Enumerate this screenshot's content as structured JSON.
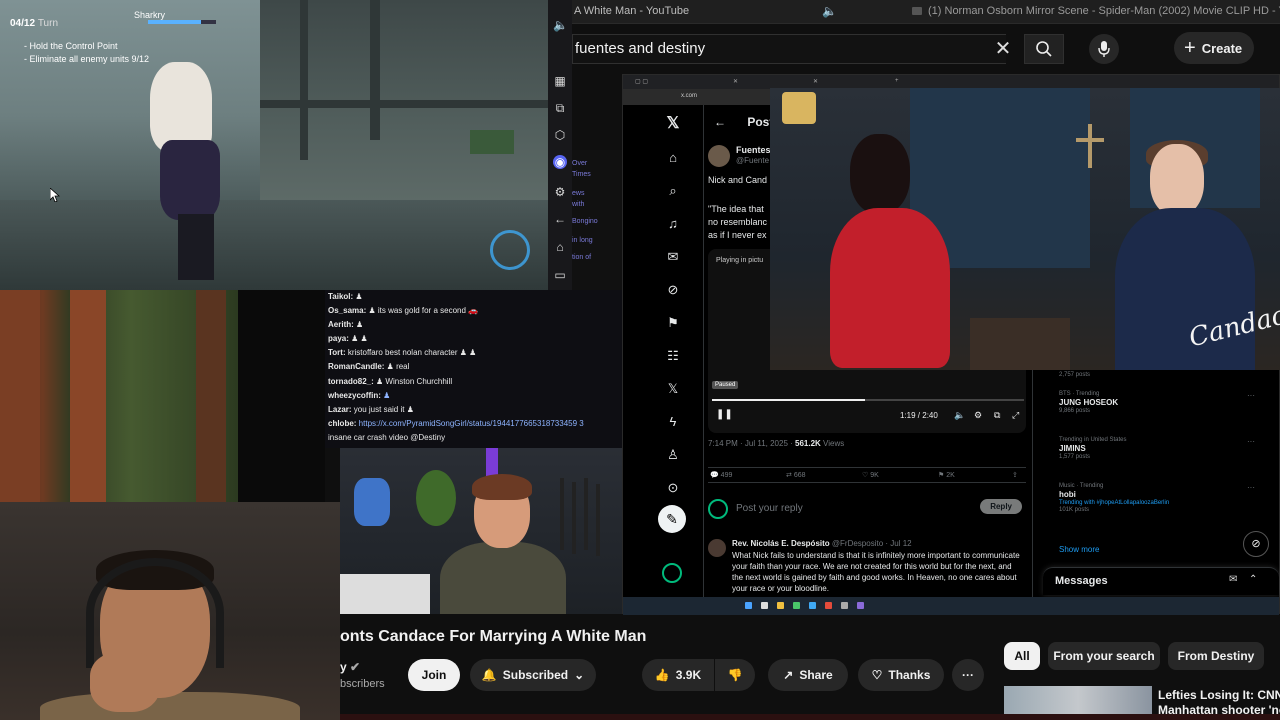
{
  "browser_tabs": {
    "tab1": "A White Man - YouTube",
    "tab2": "(1) Norman Osborn Mirror Scene - Spider-Man (2002) Movie CLIP HD - YouTube"
  },
  "youtube": {
    "search_query": "fuentes and destiny",
    "create_label": "Create",
    "video_title": "onts Candace For Marrying A White Man",
    "channel_name": "y",
    "subscribers": "bscribers",
    "join_label": "Join",
    "subscribed_label": "Subscribed",
    "like_count": "3.9K",
    "share_label": "Share",
    "thanks_label": "Thanks",
    "chips": [
      "All",
      "From your search",
      "From Destiny"
    ],
    "related_title_line1": "Lefties Losing It: CNN",
    "related_title_line2": "Manhattan shooter 'no"
  },
  "game": {
    "turn_value": "04/12",
    "turn_label": "Turn",
    "objective1": "- Hold the Control Point",
    "objective2": "- Eliminate all enemy units 9/12",
    "player_name": "Sharkry",
    "hp_fraction": 0.78
  },
  "x_post": {
    "header": "Post",
    "author_name": "Fuentes I",
    "author_handle": "@Fuente",
    "text_line": "Nick and Cand",
    "quote_text": "\"The idea that no resemblanc as if I never ex",
    "pip_label": "Playing in pictu",
    "paused_label": "Paused",
    "video_time": "1:19 / 2:40",
    "progress_fraction": 0.49,
    "post_time": "7:14 PM · Jul 11, 2025 · ",
    "views_count": "561.2K",
    "views_label": "Views",
    "replies": "499",
    "reposts": "668",
    "likes": "9K",
    "bookmarks": "2K",
    "reply_placeholder": "Post your reply",
    "reply_button": "Reply",
    "comment_author": "Rev. Nicolás E. Despósito",
    "comment_handle": "@FrDesposito · Jul 12",
    "comment_text": "What Nick fails to understand is that it is infinitely more important to communicate your faith than your race. We are not created for this world but for the next, and the next world is gained by faith and good works. In Heaven, no one cares about your race or your bloodline."
  },
  "trends": [
    {
      "category": "",
      "name": "",
      "count": "2,757 posts"
    },
    {
      "category": "BTS · Trending",
      "name": "JUNG HOSEOK",
      "count": "9,866 posts"
    },
    {
      "category": "Trending in United States",
      "name": "JIMINS",
      "count": "1,577 posts"
    },
    {
      "category": "Music · Trending",
      "name": "hobi",
      "count": "Trending with #jhopeAtLollapaloozaBerlin"
    },
    {
      "category": "",
      "name": "",
      "count": "101K posts"
    }
  ],
  "show_more": "Show more",
  "messages_label": "Messages",
  "interview_signature": "Candace",
  "chat": [
    {
      "user": "Taikol:",
      "msg": " ♟",
      "color": "#e8e8e8"
    },
    {
      "user": "Os_sama:",
      "msg": " ♟ its was gold for a second 🚗",
      "color": "#e8e8e8"
    },
    {
      "user": "Aerith:",
      "msg": " ♟",
      "color": "#e8e8e8"
    },
    {
      "user": "paya:",
      "msg": " ♟ ♟",
      "color": "#e8e8e8"
    },
    {
      "user": "Tort:",
      "msg": " kristoffaro best nolan character ♟ ♟",
      "color": "#e8e8e8"
    },
    {
      "user": "RomanCandle:",
      "msg": " ♟ real",
      "color": "#e8e8e8"
    },
    {
      "user": "tornado82_:",
      "msg": " ♟ Winston Churchhill",
      "color": "#e8e8e8"
    },
    {
      "user": "wheezycoffin:",
      "msg": " ♟",
      "color": "#8eb4ff"
    },
    {
      "user": "Lazar:",
      "msg": " you just said it ♟",
      "color": "#e8e8e8"
    },
    {
      "user": "chlobe:",
      "msg": " https://x.com/PyramidSongGirl/status/1944177665318733459 3",
      "color": "#8eb4ff"
    },
    {
      "user": "",
      "msg": "insane car crash video @Destiny",
      "color": "#e8e8e8"
    }
  ],
  "side_links": [
    "Over",
    "Times",
    "ews",
    "with",
    "Bongino",
    "in long",
    "tion of"
  ]
}
